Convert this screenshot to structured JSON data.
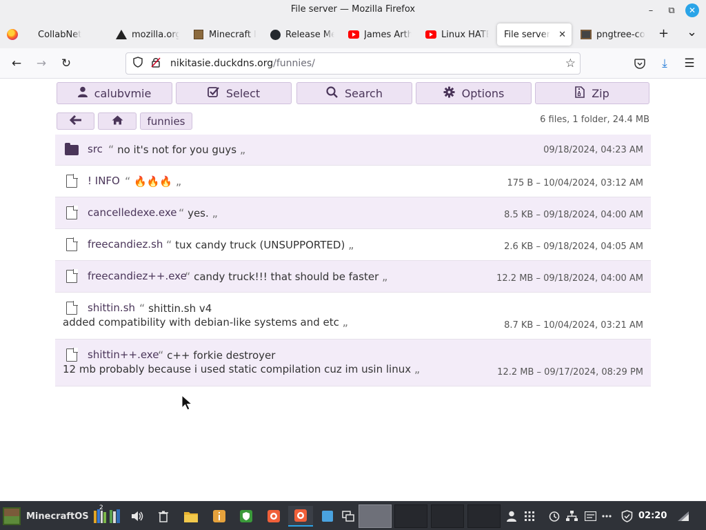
{
  "window": {
    "title": "File server — Mozilla Firefox",
    "controls": {
      "minimize": "–",
      "maximize": "⧉",
      "close": "✕"
    }
  },
  "tabs": [
    {
      "label": "CollabNet",
      "icon": "firefox-icon"
    },
    {
      "label": "mozilla.org",
      "icon": "warning-icon"
    },
    {
      "label": "Minecraft la",
      "icon": "minecraft-icon"
    },
    {
      "label": "Release Me",
      "icon": "github-icon"
    },
    {
      "label": "James Arth",
      "icon": "youtube-icon"
    },
    {
      "label": "Linux HATE",
      "icon": "youtube-icon"
    },
    {
      "label": "File server",
      "icon": "none",
      "active": true,
      "close": "✕"
    },
    {
      "label": "pngtree-co",
      "icon": "image-icon"
    }
  ],
  "tabstrip": {
    "new_tab": "+",
    "list_all": "⌄"
  },
  "navbar": {
    "back": "←",
    "forward": "→",
    "reload": "↻",
    "url_host": "nikitasie.duckdns.org",
    "url_path": "/funnies/",
    "bookmark": "☆",
    "pocket": "◡",
    "downloads": "⤓",
    "menu": "☰"
  },
  "toolbar": {
    "user": {
      "label": "calubvmie",
      "icon": "user-icon"
    },
    "select": {
      "label": "Select",
      "icon": "checkbox-icon"
    },
    "search": {
      "label": "Search",
      "icon": "search-icon"
    },
    "options": {
      "label": "Options",
      "icon": "gear-icon"
    },
    "zip": {
      "label": "Zip",
      "icon": "zip-icon"
    }
  },
  "breadcrumb": {
    "back": "🡐",
    "home": "⌂",
    "folder": "funnies"
  },
  "summary": "6 files, 1 folder, 24.4 MB",
  "quote_open": "“",
  "quote_close": "„",
  "files": [
    {
      "type": "folder",
      "name": "src",
      "desc": "no it's not for you guys",
      "meta": "09/18/2024, 04:23 AM"
    },
    {
      "type": "file",
      "name": "! INFO",
      "desc": "🔥🔥🔥",
      "meta": "175 B – 10/04/2024, 03:12 AM"
    },
    {
      "type": "file",
      "name": "cancelledexe.exe",
      "desc": "yes.",
      "meta": "8.5 KB – 09/18/2024, 04:00 AM"
    },
    {
      "type": "file",
      "name": "freecandiez.sh",
      "desc": "tux candy truck (UNSUPPORTED)",
      "meta": "2.6 KB – 09/18/2024, 04:05 AM"
    },
    {
      "type": "file",
      "name": "freecandiez++.exe",
      "desc": "candy truck!!! that should be faster",
      "meta": "12.2 MB – 09/18/2024, 04:00 AM"
    },
    {
      "type": "file",
      "name": "shittin.sh",
      "desc": "shittin.sh v4",
      "desc2": "added compatibility with debian-like systems and etc",
      "meta": "8.7 KB – 10/04/2024, 03:21 AM"
    },
    {
      "type": "file",
      "name": "shittin++.exe",
      "desc": "c++ forkie destroyer",
      "desc2": "12 mb probably because i used static compilation cuz im usin linux",
      "meta": "12.2 MB – 09/17/2024, 08:29 PM"
    }
  ],
  "taskbar": {
    "start_label": "MinecraftOS",
    "badge": "2",
    "clock": "02:20"
  },
  "colors": {
    "accent": "#4a3559",
    "button_bg": "#ede3f3",
    "row_shade": "#f3ecf8",
    "taskbar": "#2f3238",
    "close_blue": "#2aa4e8"
  }
}
